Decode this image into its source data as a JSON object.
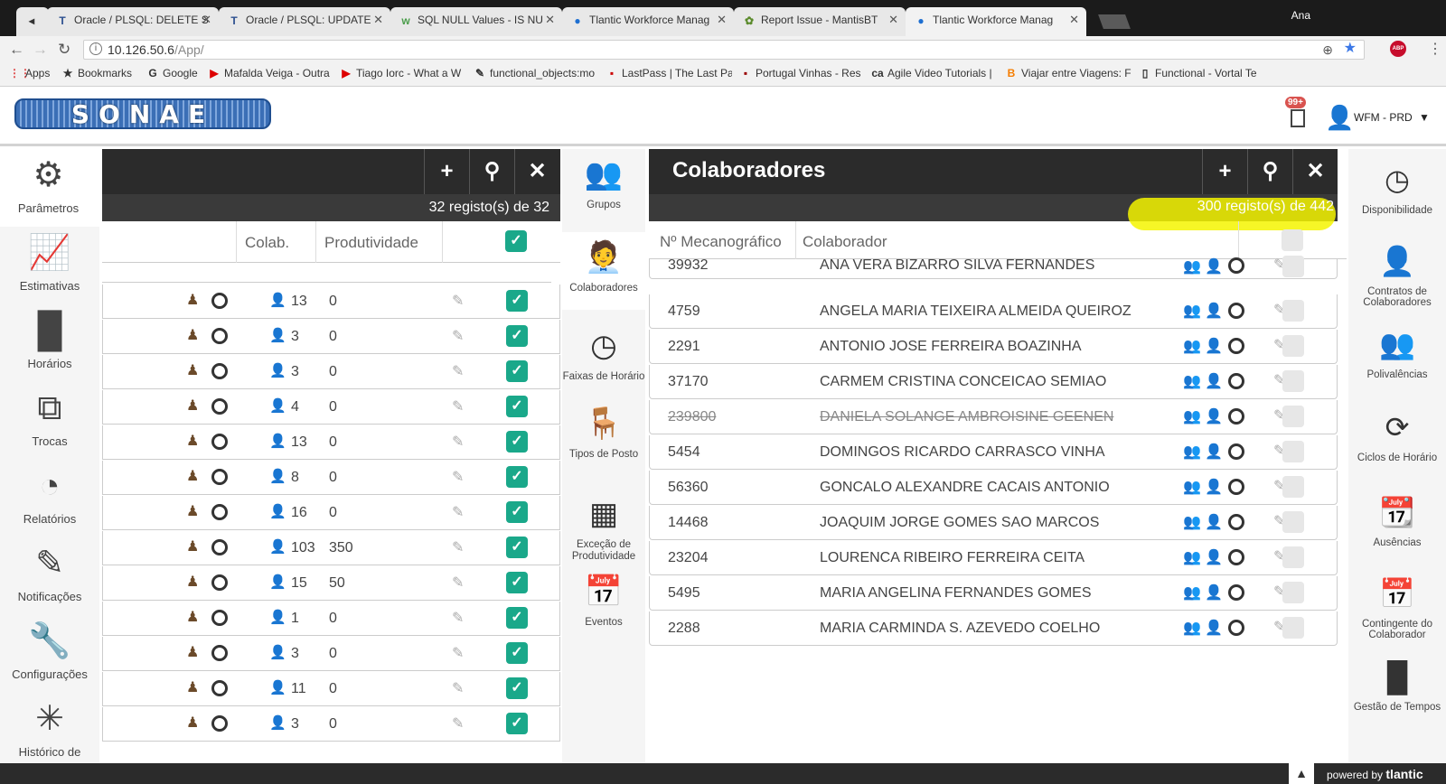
{
  "browser": {
    "tabs": [
      {
        "icon": "mute-icon",
        "label": ""
      },
      {
        "icon": "T",
        "label": "Oracle / PLSQL: DELETE S"
      },
      {
        "icon": "T",
        "label": "Oracle / PLSQL: UPDATE"
      },
      {
        "icon": "w3",
        "label": "SQL NULL Values - IS NU"
      },
      {
        "icon": "tl",
        "label": "Tlantic Workforce Manag"
      },
      {
        "icon": "bug",
        "label": "Report Issue - MantisBT"
      },
      {
        "icon": "tl",
        "label": "Tlantic Workforce Manag"
      }
    ],
    "user": "Ana",
    "url_host": "10.126.50.6",
    "url_path": "/App/",
    "bookmarks": [
      "Apps",
      "Bookmarks",
      "Google",
      "Mafalda Veiga - Outra",
      "Tiago Iorc - What a W",
      "functional_objects:mo",
      "LastPass | The Last Pa",
      "Portugal Vinhas - Res",
      "Agile Video Tutorials |",
      "Viajar entre Viagens: F",
      "Functional - Vortal Te"
    ],
    "abp": "ABP"
  },
  "app": {
    "logo": "SONAE",
    "notif_badge": "99+",
    "env": "WFM - PRD"
  },
  "leftnav": [
    "Parâmetros",
    "Estimativas",
    "Horários",
    "Trocas",
    "Relatórios",
    "Notificações",
    "Configurações",
    "Histórico de"
  ],
  "leftpanel": {
    "count": "32  registo(s) de  32",
    "headers": {
      "colab": "Colab.",
      "prod": "Produtividade"
    },
    "rows": [
      {
        "colab": "13",
        "prod": "0"
      },
      {
        "colab": "3",
        "prod": "0"
      },
      {
        "colab": "3",
        "prod": "0"
      },
      {
        "colab": "4",
        "prod": "0"
      },
      {
        "colab": "13",
        "prod": "0"
      },
      {
        "colab": "8",
        "prod": "0"
      },
      {
        "colab": "16",
        "prod": "0"
      },
      {
        "colab": "103",
        "prod": "350"
      },
      {
        "colab": "15",
        "prod": "50"
      },
      {
        "colab": "1",
        "prod": "0"
      },
      {
        "colab": "3",
        "prod": "0"
      },
      {
        "colab": "11",
        "prod": "0"
      },
      {
        "colab": "3",
        "prod": "0"
      }
    ]
  },
  "midnav": [
    "Grupos",
    "Colaboradores",
    "Faixas de Horário",
    "Tipos de Posto",
    "Exceção de Produtividade",
    "Eventos"
  ],
  "rightpanel": {
    "title": "Colaboradores",
    "count": "300  registo(s) de  442",
    "headers": {
      "num": "Nº Mecanográfico",
      "name": "Colaborador"
    },
    "rows": [
      {
        "num": "39932",
        "name": "ANA VERA BIZARRO SILVA FERNANDES",
        "strike": false
      },
      {
        "num": "4759",
        "name": "ANGELA MARIA TEIXEIRA ALMEIDA QUEIROZ",
        "strike": false
      },
      {
        "num": "2291",
        "name": "ANTONIO JOSE FERREIRA BOAZINHA",
        "strike": false
      },
      {
        "num": "37170",
        "name": "CARMEM CRISTINA CONCEICAO SEMIAO",
        "strike": false
      },
      {
        "num": "239800",
        "name": "DANIELA SOLANGE AMBROISINE GEENEN",
        "strike": true
      },
      {
        "num": "5454",
        "name": "DOMINGOS RICARDO CARRASCO VINHA",
        "strike": false
      },
      {
        "num": "56360",
        "name": "GONCALO ALEXANDRE CACAIS ANTONIO",
        "strike": false
      },
      {
        "num": "14468",
        "name": "JOAQUIM JORGE GOMES SAO MARCOS",
        "strike": false
      },
      {
        "num": "23204",
        "name": "LOURENCA RIBEIRO FERREIRA CEITA",
        "strike": false
      },
      {
        "num": "5495",
        "name": "MARIA ANGELINA FERNANDES GOMES",
        "strike": false
      },
      {
        "num": "2288",
        "name": "MARIA CARMINDA S. AZEVEDO COELHO",
        "strike": false
      }
    ]
  },
  "rightnav": [
    "Disponibilidade",
    "Contratos de Colaboradores",
    "Polivalências",
    "Ciclos de Horário",
    "Ausências",
    "Contingente do Colaborador",
    "Gestão de Tempos"
  ],
  "footer": {
    "powered": "powered by",
    "brand": "tlantic"
  }
}
